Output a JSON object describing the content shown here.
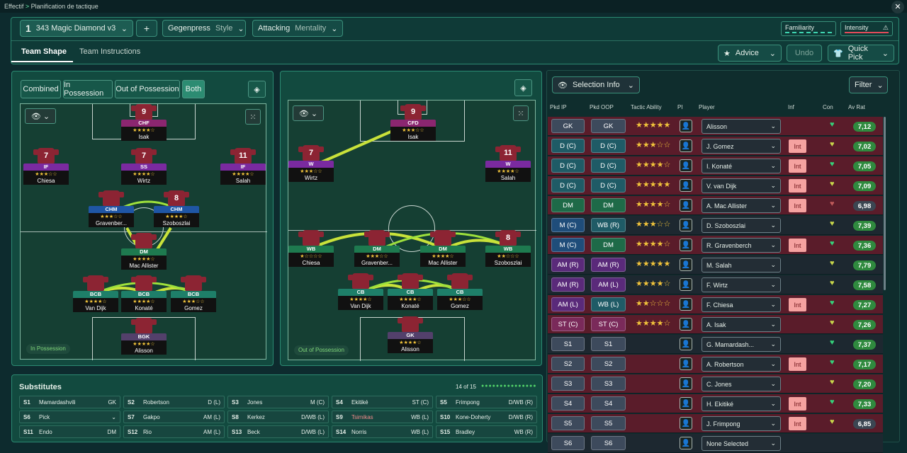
{
  "breadcrumb": {
    "root": "Effectif",
    "sep": ">",
    "current": "Planification de tactique"
  },
  "tactic": {
    "number": "1",
    "name": "343 Magic Diamond v3",
    "add": "+",
    "style_value": "Gegenpress",
    "style_label": "Style",
    "mentality_value": "Attacking",
    "mentality_label": "Mentality",
    "familiarity": "Familiarity",
    "intensity": "Intensity"
  },
  "tabs": [
    "Team Shape",
    "Team Instructions"
  ],
  "actions": {
    "advice": "Advice",
    "undo": "Undo",
    "quick_pick": "Quick Pick"
  },
  "view_toggles": [
    "Combined",
    "In Possession",
    "Out of Possession",
    "Both"
  ],
  "pitch_labels": {
    "in": "In Possession",
    "out": "Out of Possession"
  },
  "players_in": [
    {
      "n": "9",
      "role": "CHF",
      "name": "Isak",
      "rc": "#8b2670",
      "s": "★★★★☆"
    },
    {
      "n": "7",
      "role": "IF",
      "name": "Chiesa",
      "rc": "#7a2aa0",
      "s": "★★★☆☆"
    },
    {
      "n": "7",
      "role": "SS",
      "name": "Wirtz",
      "rc": "#7a2aa0",
      "s": "★★★★☆"
    },
    {
      "n": "11",
      "role": "IF",
      "name": "Salah",
      "rc": "#7a2aa0",
      "s": "★★★★☆"
    },
    {
      "n": "",
      "role": "CHM",
      "name": "Gravenber...",
      "rc": "#1f56a5",
      "s": "★★★☆☆"
    },
    {
      "n": "8",
      "role": "CHM",
      "name": "Szoboszlai",
      "rc": "#1f56a5",
      "s": "★★★★☆"
    },
    {
      "n": "",
      "role": "DM",
      "name": "Mac Allister",
      "rc": "#1e7a4f",
      "s": "★★★★☆"
    },
    {
      "n": "",
      "role": "BCB",
      "name": "Van Dijk",
      "rc": "#1e7f69",
      "s": "★★★★☆"
    },
    {
      "n": "",
      "role": "BCB",
      "name": "Konaté",
      "rc": "#1e7f69",
      "s": "★★★★☆"
    },
    {
      "n": "",
      "role": "BCB",
      "name": "Gomez",
      "rc": "#1e7f69",
      "s": "★★★☆☆"
    },
    {
      "n": "",
      "role": "BGK",
      "name": "Alisson",
      "rc": "#53406b",
      "s": "★★★★☆"
    }
  ],
  "players_out": [
    {
      "n": "9",
      "role": "CFD",
      "name": "Isak",
      "rc": "#8b2670",
      "s": "★★★☆☆"
    },
    {
      "n": "7",
      "role": "W",
      "name": "Wirtz",
      "rc": "#7a2aa0",
      "s": "★★★☆☆"
    },
    {
      "n": "11",
      "role": "W",
      "name": "Salah",
      "rc": "#7a2aa0",
      "s": "★★★★☆"
    },
    {
      "n": "",
      "role": "WB",
      "name": "Chiesa",
      "rc": "#1e7a4f",
      "s": "★☆☆☆☆"
    },
    {
      "n": "",
      "role": "DM",
      "name": "Gravenber...",
      "rc": "#1e7a4f",
      "s": "★★★☆☆"
    },
    {
      "n": "",
      "role": "DM",
      "name": "Mac Allister",
      "rc": "#1e7a4f",
      "s": "★★★★☆"
    },
    {
      "n": "8",
      "role": "WB",
      "name": "Szoboszlai",
      "rc": "#1e7a4f",
      "s": "★★☆☆☆"
    },
    {
      "n": "",
      "role": "CB",
      "name": "Van Dijk",
      "rc": "#1e7f69",
      "s": "★★★★☆"
    },
    {
      "n": "",
      "role": "CB",
      "name": "Konaté",
      "rc": "#1e7f69",
      "s": "★★★★☆"
    },
    {
      "n": "",
      "role": "CB",
      "name": "Gomez",
      "rc": "#1e7f69",
      "s": "★★★☆☆"
    },
    {
      "n": "",
      "role": "GK",
      "name": "Alisson",
      "rc": "#53406b",
      "s": "★★★★☆"
    }
  ],
  "subs": {
    "title": "Substitutes",
    "count": "14 of 15",
    "items": [
      [
        "S1",
        "Mamardashvili",
        "GK"
      ],
      [
        "S2",
        "Robertson",
        "D (L)"
      ],
      [
        "S3",
        "Jones",
        "M (C)"
      ],
      [
        "S4",
        "Ekitiké",
        "ST (C)"
      ],
      [
        "S5",
        "Frimpong",
        "D/WB (R)"
      ],
      [
        "S6",
        "Pick",
        ""
      ],
      [
        "S7",
        "Gakpo",
        "AM (L)"
      ],
      [
        "S8",
        "Kerkez",
        "D/WB (L)"
      ],
      [
        "S9",
        "Tsimikas",
        "WB (L)"
      ],
      [
        "S10",
        "Kone-Doherty",
        "D/WB (R)"
      ],
      [
        "S11",
        "Endo",
        "DM"
      ],
      [
        "S12",
        "Rio",
        "AM (L)"
      ],
      [
        "S13",
        "Beck",
        "D/WB (L)"
      ],
      [
        "S14",
        "Norris",
        "WB (L)"
      ],
      [
        "S15",
        "Bradley",
        "WB (R)"
      ]
    ]
  },
  "selection": {
    "button": "Selection Info",
    "filter": "Filter",
    "headers": [
      "Pkd IP",
      "Pkd OOP",
      "Tactic Ability",
      "PI",
      "Player",
      "Inf",
      "Con",
      "Av Rat"
    ]
  },
  "rows": [
    {
      "ip": "GK",
      "oop": "GK",
      "s": "★★★★★",
      "p": "Alisson",
      "inf": "",
      "r": "7,12",
      "ci": "#3d4a5c",
      "co": "#3d4a5c",
      "bg": "#5a1c2a",
      "h": "#35d27a",
      "rc": "#2f8a3e"
    },
    {
      "ip": "D (C)",
      "oop": "D (C)",
      "s": "★★★☆☆",
      "p": "J. Gomez",
      "inf": "Int",
      "r": "7,02",
      "ci": "#1f5b66",
      "co": "#1f5b66",
      "bg": "#5a1c2a",
      "h": "#c8d64a",
      "rc": "#2f8a3e"
    },
    {
      "ip": "D (C)",
      "oop": "D (C)",
      "s": "★★★★☆",
      "p": "I. Konaté",
      "inf": "Int",
      "r": "7,05",
      "ci": "#1f5b66",
      "co": "#1f5b66",
      "bg": "#5a1c2a",
      "h": "#35d27a",
      "rc": "#2f8a3e"
    },
    {
      "ip": "D (C)",
      "oop": "D (C)",
      "s": "★★★★★",
      "p": "V. van Dijk",
      "inf": "Int",
      "r": "7,09",
      "ci": "#1f5b66",
      "co": "#1f5b66",
      "bg": "#5a1c2a",
      "h": "#c8d64a",
      "rc": "#2f8a3e"
    },
    {
      "ip": "DM",
      "oop": "DM",
      "s": "★★★★☆",
      "p": "A. Mac Allister",
      "inf": "Int",
      "r": "6,98",
      "ci": "#1e6a48",
      "co": "#1e6a48",
      "bg": "#5a1c2a",
      "h": "#c05a5a",
      "rc": "#3b4652"
    },
    {
      "ip": "M (C)",
      "oop": "WB (R)",
      "s": "★★★☆☆",
      "p": "D. Szoboszlai",
      "inf": "",
      "r": "7,39",
      "ci": "#1f4d7a",
      "co": "#1f5b66",
      "bg": "#1d2830",
      "h": "#c8d64a",
      "rc": "#2f8a3e"
    },
    {
      "ip": "M (C)",
      "oop": "DM",
      "s": "★★★★☆",
      "p": "R. Gravenberch",
      "inf": "Int",
      "r": "7,36",
      "ci": "#1f4d7a",
      "co": "#1e6a48",
      "bg": "#5a1c2a",
      "h": "#35d27a",
      "rc": "#2f8a3e"
    },
    {
      "ip": "AM (R)",
      "oop": "AM (R)",
      "s": "★★★★★",
      "p": "M. Salah",
      "inf": "",
      "r": "7,79",
      "ci": "#5a2a7a",
      "co": "#5a2a7a",
      "bg": "#1d2830",
      "h": "#c8d64a",
      "rc": "#2f8a3e"
    },
    {
      "ip": "AM (R)",
      "oop": "AM (L)",
      "s": "★★★★☆",
      "p": "F. Wirtz",
      "inf": "",
      "r": "7,58",
      "ci": "#5a2a7a",
      "co": "#5a2a7a",
      "bg": "#1d2830",
      "h": "#c8d64a",
      "rc": "#2f8a3e"
    },
    {
      "ip": "AM (L)",
      "oop": "WB (L)",
      "s": "★★☆☆☆",
      "p": "F. Chiesa",
      "inf": "Int",
      "r": "7,27",
      "ci": "#5a2a7a",
      "co": "#1f5b66",
      "bg": "#5a1c2a",
      "h": "#35d27a",
      "rc": "#2f8a3e"
    },
    {
      "ip": "ST (C)",
      "oop": "ST (C)",
      "s": "★★★★☆",
      "p": "A. Isak",
      "inf": "",
      "r": "7,26",
      "ci": "#7a2a5a",
      "co": "#7a2a5a",
      "bg": "#5a1c2a",
      "h": "#c8d64a",
      "rc": "#2f8a3e"
    },
    {
      "ip": "S1",
      "oop": "S1",
      "s": "",
      "p": "G. Mamardash...",
      "inf": "",
      "r": "7,37",
      "ci": "#3d4a5c",
      "co": "#3d4a5c",
      "bg": "#1d2830",
      "h": "#35d27a",
      "rc": "#2f8a3e"
    },
    {
      "ip": "S2",
      "oop": "S2",
      "s": "",
      "p": "A. Robertson",
      "inf": "Int",
      "r": "7,17",
      "ci": "#3d4a5c",
      "co": "#3d4a5c",
      "bg": "#5a1c2a",
      "h": "#35d27a",
      "rc": "#2f8a3e"
    },
    {
      "ip": "S3",
      "oop": "S3",
      "s": "",
      "p": "C. Jones",
      "inf": "",
      "r": "7,20",
      "ci": "#3d4a5c",
      "co": "#3d4a5c",
      "bg": "#5a1c2a",
      "h": "#c8d64a",
      "rc": "#2f8a3e"
    },
    {
      "ip": "S4",
      "oop": "S4",
      "s": "",
      "p": "H. Ekitiké",
      "inf": "Int",
      "r": "7,33",
      "ci": "#3d4a5c",
      "co": "#3d4a5c",
      "bg": "#5a1c2a",
      "h": "#35d27a",
      "rc": "#2f8a3e"
    },
    {
      "ip": "S5",
      "oop": "S5",
      "s": "",
      "p": "J. Frimpong",
      "inf": "Int",
      "r": "6,85",
      "ci": "#3d4a5c",
      "co": "#3d4a5c",
      "bg": "#5a1c2a",
      "h": "#c8d64a",
      "rc": "#3b4652"
    },
    {
      "ip": "S6",
      "oop": "S6",
      "s": "",
      "p": "None Selected",
      "inf": "",
      "r": "",
      "ci": "#3d4a5c",
      "co": "#3d4a5c",
      "bg": "#1d2830",
      "h": "",
      "rc": ""
    }
  ]
}
